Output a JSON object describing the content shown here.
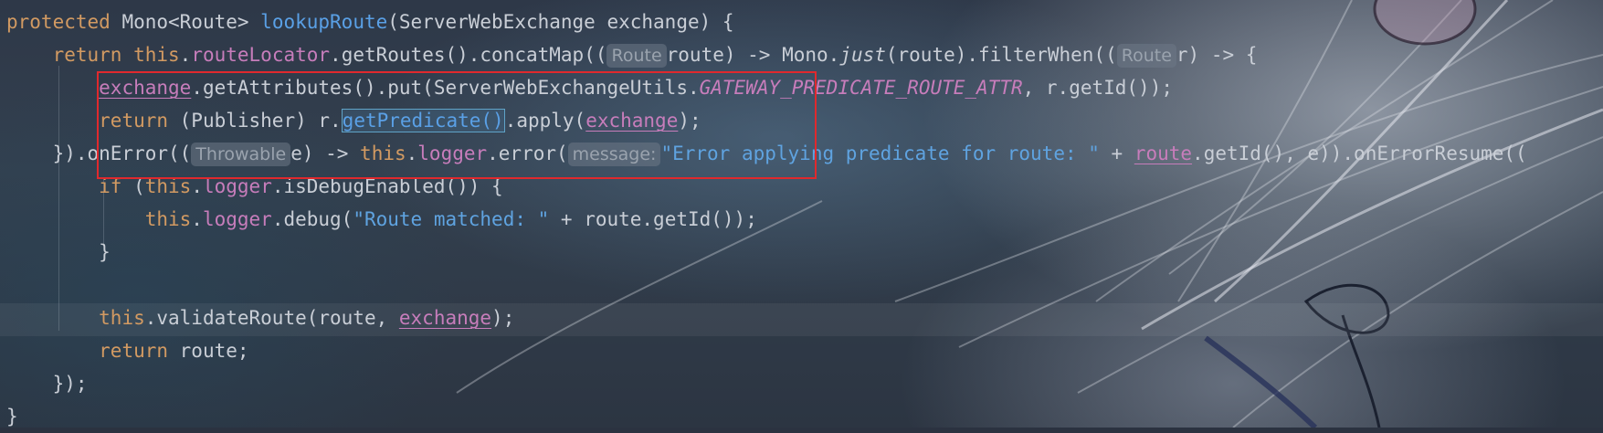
{
  "editor": {
    "lines": [
      {
        "tokens": [
          {
            "t": "protected",
            "c": "kw"
          },
          {
            "t": " Mono<Route> "
          },
          {
            "t": "lookupRoute",
            "c": "fn"
          },
          {
            "t": "(ServerWebExchange exchange) {"
          }
        ]
      },
      {
        "tokens": [
          {
            "t": "    "
          },
          {
            "t": "return",
            "c": "kw"
          },
          {
            "t": " "
          },
          {
            "t": "this",
            "c": "kw"
          },
          {
            "t": "."
          },
          {
            "t": "routeLocator",
            "c": "field"
          },
          {
            "t": ".getRoutes().concatMap(("
          },
          {
            "t": "Route",
            "c": "hint"
          },
          {
            "t": "route) -> Mono."
          },
          {
            "t": "just",
            "c": "italic"
          },
          {
            "t": "(route).filterWhen(("
          },
          {
            "t": "Route",
            "c": "hint"
          },
          {
            "t": "r) -> {"
          }
        ]
      },
      {
        "tokens": [
          {
            "t": "        "
          },
          {
            "t": "exchange",
            "c": "field uline"
          },
          {
            "t": ".getAttributes().put(ServerWebExchangeUtils."
          },
          {
            "t": "GATEWAY_PREDICATE_ROUTE_ATTR",
            "c": "static"
          },
          {
            "t": ", r.getId());"
          }
        ]
      },
      {
        "tokens": [
          {
            "t": "        "
          },
          {
            "t": "return",
            "c": "kw"
          },
          {
            "t": " (Publisher) r."
          },
          {
            "t": "getPredicate()",
            "c": "fn boxed"
          },
          {
            "t": ".apply("
          },
          {
            "t": "exchange",
            "c": "field uline"
          },
          {
            "t": ");"
          }
        ]
      },
      {
        "tokens": [
          {
            "t": "    }).onError(("
          },
          {
            "t": "Throwable",
            "c": "hint"
          },
          {
            "t": "e) -> "
          },
          {
            "t": "this",
            "c": "kw"
          },
          {
            "t": "."
          },
          {
            "t": "logger",
            "c": "field"
          },
          {
            "t": ".error("
          },
          {
            "t": "message:",
            "c": "hint"
          },
          {
            "t": "\"Error applying predicate for route: \"",
            "c": "str"
          },
          {
            "t": " + "
          },
          {
            "t": "route",
            "c": "field uline"
          },
          {
            "t": ".getId(), e)).onErrorResume(("
          }
        ]
      },
      {
        "tokens": [
          {
            "t": "        "
          },
          {
            "t": "if",
            "c": "kw"
          },
          {
            "t": " ("
          },
          {
            "t": "this",
            "c": "kw"
          },
          {
            "t": "."
          },
          {
            "t": "logger",
            "c": "field"
          },
          {
            "t": ".isDebugEnabled()) {"
          }
        ]
      },
      {
        "tokens": [
          {
            "t": "            "
          },
          {
            "t": "this",
            "c": "kw"
          },
          {
            "t": "."
          },
          {
            "t": "logger",
            "c": "field"
          },
          {
            "t": ".debug("
          },
          {
            "t": "\"Route matched: \"",
            "c": "str"
          },
          {
            "t": " + route.getId());"
          }
        ]
      },
      {
        "tokens": [
          {
            "t": "        }"
          }
        ]
      },
      {
        "tokens": [
          {
            "t": ""
          }
        ]
      },
      {
        "tokens": [
          {
            "t": "        "
          },
          {
            "t": "this",
            "c": "kw"
          },
          {
            "t": ".validateRoute(route, "
          },
          {
            "t": "exchange",
            "c": "field uline"
          },
          {
            "t": ");"
          }
        ]
      },
      {
        "tokens": [
          {
            "t": "        "
          },
          {
            "t": "return",
            "c": "kw"
          },
          {
            "t": " route;"
          }
        ]
      },
      {
        "tokens": [
          {
            "t": "    });"
          }
        ]
      },
      {
        "tokens": [
          {
            "t": "}"
          }
        ]
      }
    ]
  },
  "colors": {
    "keyword": "#d29a62",
    "function": "#5aa0e6",
    "field": "#c77dbb",
    "string": "#5fa3e0",
    "default_text": "#c9ced6",
    "annotation_box": "#e0292d"
  }
}
